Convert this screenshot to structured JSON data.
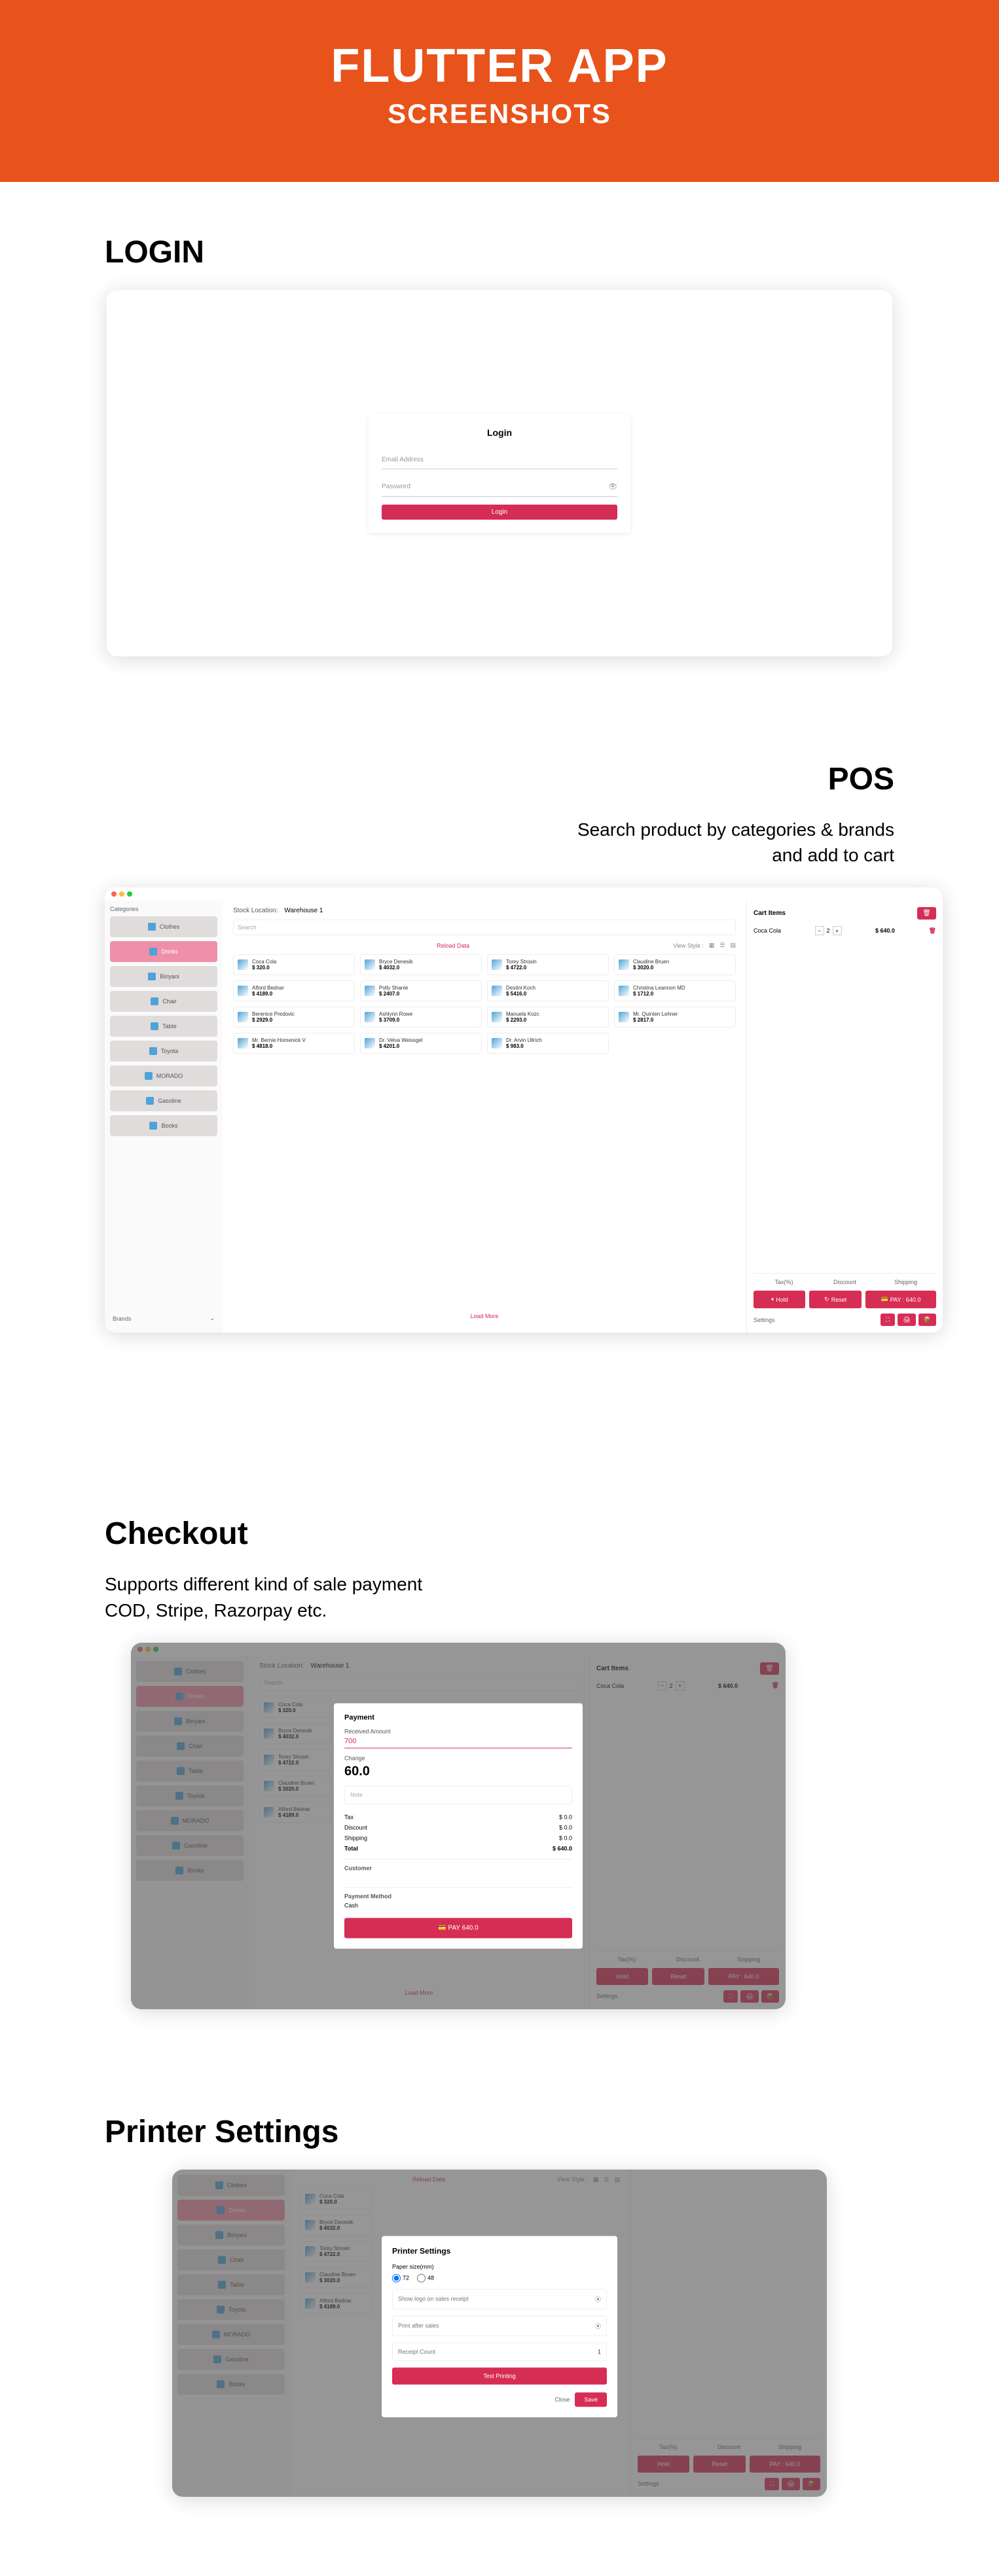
{
  "hero": {
    "title": "FLUTTER APP",
    "subtitle": "SCREENSHOTS"
  },
  "login": {
    "section_title": "LOGIN",
    "card_title": "Login",
    "email_ph": "Email Address",
    "password_ph": "Password",
    "button": "Login"
  },
  "pos": {
    "section_title": "POS",
    "sub1": "Search product by categories & brands",
    "sub2": "and add to cart",
    "sidebar_title": "Categories",
    "categories": [
      "Clothes",
      "Drinks",
      "Biriyani",
      "Chair",
      "Table",
      "Toyota",
      "MORADO",
      "Gasoline",
      "Books"
    ],
    "brands_label": "Brands",
    "stock_label": "Stock Location:",
    "stock_value": "Warehouse 1",
    "search_ph": "Search",
    "reload": "Reload Data",
    "view_style": "View Style :",
    "products": [
      {
        "n": "Coca Cola",
        "p": "$ 320.0"
      },
      {
        "n": "Bryce Denesik",
        "p": "$ 4032.0"
      },
      {
        "n": "Torey Strosin",
        "p": "$ 4722.0"
      },
      {
        "n": "Claudine Bruen",
        "p": "$ 3020.0"
      },
      {
        "n": "Alford Bednar",
        "p": "$ 4189.0"
      },
      {
        "n": "Polly Shanie",
        "p": "$ 2407.0"
      },
      {
        "n": "Destini Koch",
        "p": "$ 5416.0"
      },
      {
        "n": "Christina Leannon MD",
        "p": "$ 1712.0"
      },
      {
        "n": "Berenice Predovic",
        "p": "$ 2929.0"
      },
      {
        "n": "Ashlynn Rowe",
        "p": "$ 3709.0"
      },
      {
        "n": "Manuela Kozc",
        "p": "$ 2293.0"
      },
      {
        "n": "Mr. Quinten Lehner",
        "p": "$ 2817.0"
      },
      {
        "n": "Mr. Bernie Homenick V",
        "p": "$ 4818.0"
      },
      {
        "n": "Dr. Velva Weissgel",
        "p": "$ 4201.0"
      },
      {
        "n": "Dr. Arvin Ullrich",
        "p": "$ 983.0"
      }
    ],
    "load_more": "Load More",
    "cart_title": "Cart Items",
    "cart_item": {
      "name": "Coca Cola",
      "qty": "2",
      "price": "$ 640.0"
    },
    "tax": "Tax(%)",
    "discount": "Discount",
    "shipping": "Shipping",
    "hold": "Hold",
    "reset": "Reset",
    "pay": "PAY : 640.0",
    "settings": "Settings"
  },
  "checkout": {
    "section_title": "Checkout",
    "sub1": "Supports different kind of sale payment",
    "sub2": "COD, Stripe, Razorpay etc.",
    "modal_title": "Payment",
    "received_lbl": "Received Amount",
    "received_val": "700",
    "change_lbl": "Change",
    "change_val": "60.0",
    "note_ph": "Note",
    "rows": [
      {
        "l": "Tax",
        "v": "$ 0.0"
      },
      {
        "l": "Discount",
        "v": "$ 0.0"
      },
      {
        "l": "Shipping",
        "v": "$ 0.0"
      },
      {
        "l": "Total",
        "v": "$ 640.0"
      }
    ],
    "customer_lbl": "Customer",
    "pm_lbl": "Payment Method",
    "pm_val": "Cash",
    "pay_btn": "PAY 640.0"
  },
  "printer": {
    "section_title": "Printer Settings",
    "modal_title": "Printer Settings",
    "paper_lbl": "Paper size(mm)",
    "r1": "72",
    "r2": "48",
    "sel1": "Show logo on sales receipt",
    "sel2": "Print after sales",
    "receipt_lbl": "Receipt Count",
    "receipt_val": "1",
    "test_btn": "Test Printing",
    "close": "Close",
    "save": "Save"
  }
}
